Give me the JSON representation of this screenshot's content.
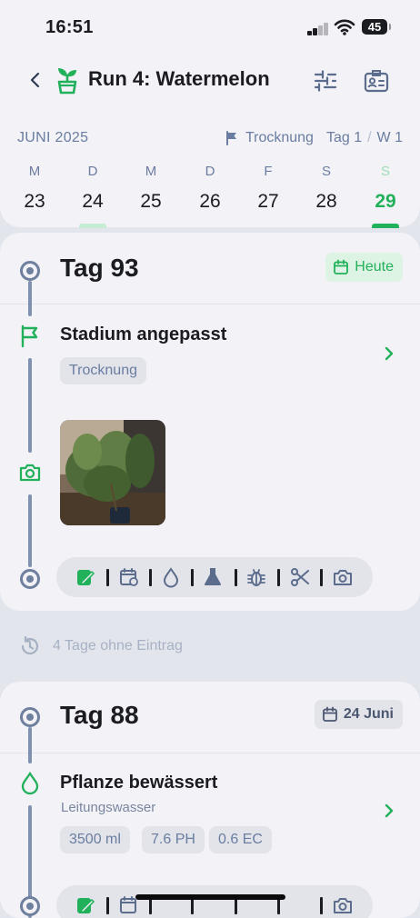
{
  "status_bar": {
    "time": "16:51",
    "battery": "45"
  },
  "header": {
    "title": "Run 4: Watermelon"
  },
  "calendar": {
    "month": "JUNI 2025",
    "stage": "Trocknung",
    "day_label": "Tag 1",
    "week_label": "W 1",
    "days": [
      {
        "weekday": "M",
        "date": "23"
      },
      {
        "weekday": "D",
        "date": "24",
        "has_entry": true
      },
      {
        "weekday": "M",
        "date": "25"
      },
      {
        "weekday": "D",
        "date": "26"
      },
      {
        "weekday": "F",
        "date": "27"
      },
      {
        "weekday": "S",
        "date": "28"
      },
      {
        "weekday": "S",
        "date": "29",
        "today": true
      }
    ]
  },
  "day1": {
    "title": "Tag 93",
    "badge": "Heute",
    "entry_title": "Stadium angepasst",
    "chip": "Trocknung",
    "photo_description": "Cannabis plant in pot"
  },
  "gap": {
    "text": "4 Tage ohne Eintrag"
  },
  "day2": {
    "title": "Tag 88",
    "date_badge": "24 Juni",
    "entry_title": "Pflanze bewässert",
    "entry_subtitle": "Leitungswasser",
    "chips": [
      "3500 ml",
      "7.6 PH",
      "0.6 EC"
    ]
  },
  "toolbar_icons": [
    "edit-note-icon",
    "calendar-repeat-icon",
    "water-drop-icon",
    "flask-icon",
    "bug-icon",
    "scissors-icon",
    "camera-icon"
  ],
  "colors": {
    "accent_green": "#22b15b",
    "slate": "#6f7f9e",
    "background": "#f2f2f7",
    "chip_bg": "#e2e4ea"
  }
}
